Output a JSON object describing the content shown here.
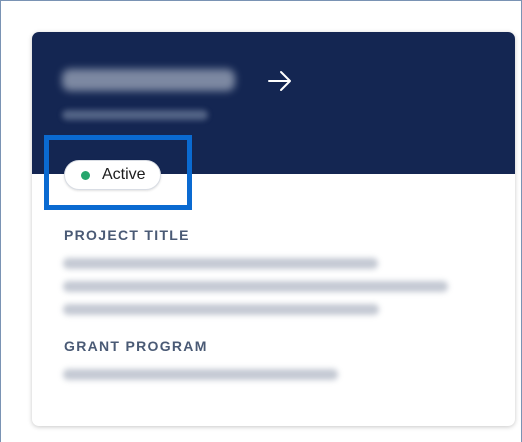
{
  "card": {
    "header": {
      "arrow_icon": "arrow-right-icon"
    },
    "status": {
      "label": "Active",
      "dot_color": "#27a66d"
    },
    "fields": {
      "project_title_label": "PROJECT TITLE",
      "grant_program_label": "GRANT PROGRAM"
    }
  },
  "colors": {
    "header_bg": "#142652",
    "highlight": "#0a6ad1",
    "label": "#4a5a75"
  }
}
